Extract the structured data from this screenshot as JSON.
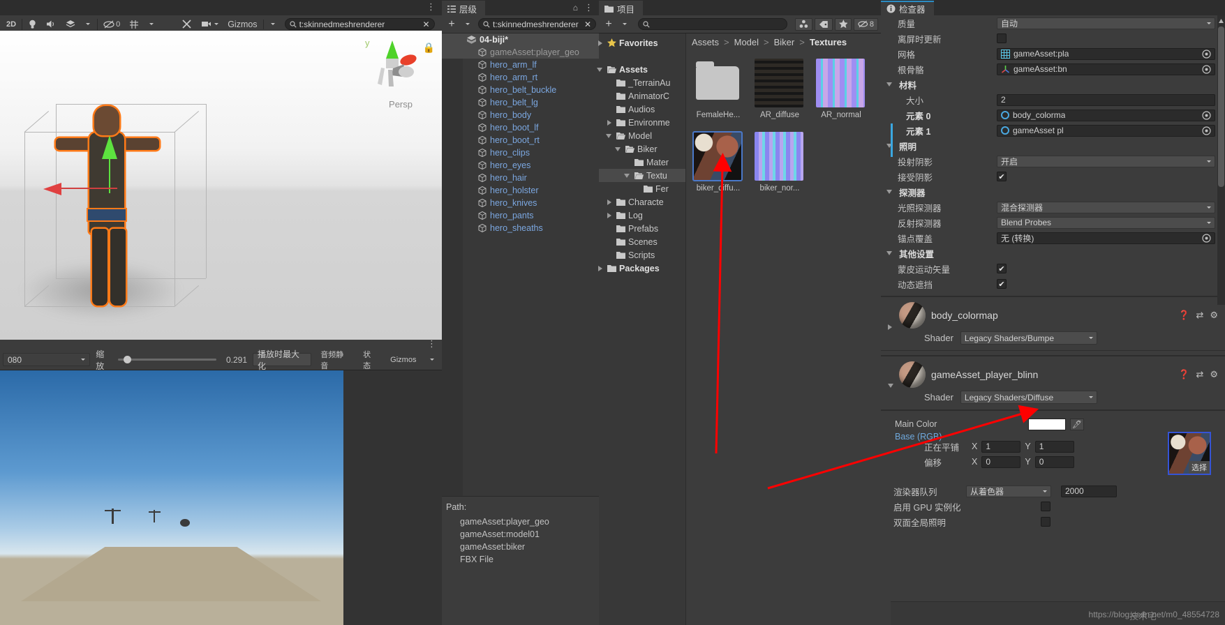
{
  "scene": {
    "toolbar": {
      "mode_2d": "2D",
      "light_icon": "lightbulb-icon",
      "audio_icon": "speaker-icon",
      "fx_icon": "effects-icon",
      "hidden_count": "0",
      "grid_icon": "grid-icon",
      "tools_icon": "tools-icon",
      "camera_icon": "camera-icon",
      "gizmos_label": "Gizmos",
      "search_value": "t:skinnedmeshrenderer",
      "search_icon": "search-icon",
      "clear_icon": "close-icon"
    },
    "persp_label": "Persp",
    "axis_y": "y",
    "lock_icon": "lock-icon"
  },
  "game": {
    "toolbar": {
      "resolution": "080",
      "zoom_label": "缩放",
      "zoom_value": "0.291",
      "maximize_label": "播放时最大化",
      "mute_label": "音频静音",
      "stats_label": "状态",
      "gizmos_label": "Gizmos"
    }
  },
  "hierarchy": {
    "tab_label": "层级",
    "tab_icon": "hierarchy-icon",
    "add_label": "+",
    "search_value": "t:skinnedmeshrenderer",
    "lock_icon": "lock-icon",
    "menu_icon": "kebab-icon",
    "root": "04-biji*",
    "items": [
      {
        "label": "gameAsset:player_geo",
        "state": "selected"
      },
      {
        "label": "hero_arm_lf",
        "state": "normal"
      },
      {
        "label": "hero_arm_rt",
        "state": "normal"
      },
      {
        "label": "hero_belt_buckle",
        "state": "normal"
      },
      {
        "label": "hero_belt_lg",
        "state": "normal"
      },
      {
        "label": "hero_body",
        "state": "normal"
      },
      {
        "label": "hero_boot_lf",
        "state": "normal"
      },
      {
        "label": "hero_boot_rt",
        "state": "normal"
      },
      {
        "label": "hero_clips",
        "state": "normal"
      },
      {
        "label": "hero_eyes",
        "state": "normal"
      },
      {
        "label": "hero_hair",
        "state": "normal"
      },
      {
        "label": "hero_holster",
        "state": "normal"
      },
      {
        "label": "hero_knives",
        "state": "normal"
      },
      {
        "label": "hero_pants",
        "state": "normal"
      },
      {
        "label": "hero_sheaths",
        "state": "normal"
      }
    ],
    "path_panel": {
      "title": "Path:",
      "items": [
        "gameAsset:player_geo",
        "gameAsset:model01",
        "gameAsset:biker",
        "FBX File"
      ]
    }
  },
  "project": {
    "tab_label": "项目",
    "tab_icon": "folder-icon",
    "add_label": "+",
    "search_value": "",
    "search_icon": "search-icon",
    "toolbar_icons": [
      "avatar-icon",
      "tag-icon",
      "star-icon",
      "hidden-icon"
    ],
    "hidden_count": "8",
    "lock_icon": "lock-icon",
    "menu_icon": "kebab-icon",
    "tree": [
      {
        "label": "Favorites",
        "indent": 0,
        "arrow": "closed",
        "icon": "star-icon",
        "bold": true
      },
      {
        "label": "",
        "indent": 0,
        "arrow": "none",
        "icon": "none",
        "bold": false
      },
      {
        "label": "Assets",
        "indent": 0,
        "arrow": "open",
        "icon": "folder-open-icon",
        "bold": true
      },
      {
        "label": "_TerrainAu",
        "indent": 1,
        "arrow": "none",
        "icon": "folder-icon",
        "bold": false
      },
      {
        "label": "AnimatorC",
        "indent": 1,
        "arrow": "none",
        "icon": "folder-icon",
        "bold": false
      },
      {
        "label": "Audios",
        "indent": 1,
        "arrow": "none",
        "icon": "folder-icon",
        "bold": false
      },
      {
        "label": "Environme",
        "indent": 1,
        "arrow": "closed",
        "icon": "folder-icon",
        "bold": false
      },
      {
        "label": "Model",
        "indent": 1,
        "arrow": "open",
        "icon": "folder-open-icon",
        "bold": false
      },
      {
        "label": "Biker",
        "indent": 2,
        "arrow": "open",
        "icon": "folder-open-icon",
        "bold": false
      },
      {
        "label": "Mater",
        "indent": 3,
        "arrow": "none",
        "icon": "folder-icon",
        "bold": false
      },
      {
        "label": "Textu",
        "indent": 3,
        "arrow": "open",
        "icon": "folder-open-icon",
        "bold": false,
        "selected": true
      },
      {
        "label": "Fer",
        "indent": 4,
        "arrow": "none",
        "icon": "folder-icon",
        "bold": false
      },
      {
        "label": "Characte",
        "indent": 1,
        "arrow": "closed",
        "icon": "folder-icon",
        "bold": false
      },
      {
        "label": "Log",
        "indent": 1,
        "arrow": "closed",
        "icon": "folder-icon",
        "bold": false
      },
      {
        "label": "Prefabs",
        "indent": 1,
        "arrow": "none",
        "icon": "folder-icon",
        "bold": false
      },
      {
        "label": "Scenes",
        "indent": 1,
        "arrow": "none",
        "icon": "folder-icon",
        "bold": false
      },
      {
        "label": "Scripts",
        "indent": 1,
        "arrow": "none",
        "icon": "folder-icon",
        "bold": false
      },
      {
        "label": "Packages",
        "indent": 0,
        "arrow": "closed",
        "icon": "folder-icon",
        "bold": true
      }
    ],
    "breadcrumb": [
      "Assets",
      "Model",
      "Biker",
      "Textures"
    ],
    "assets": [
      {
        "label": "FemaleHe...",
        "kind": "folder"
      },
      {
        "label": "AR_diffuse",
        "kind": "texture-ar-diffuse"
      },
      {
        "label": "AR_normal",
        "kind": "texture-ar-normal"
      },
      {
        "label": "biker_diffu...",
        "kind": "texture-diffuse",
        "selected": true
      },
      {
        "label": "biker_nor...",
        "kind": "texture-normal"
      }
    ]
  },
  "inspector": {
    "tab_label": "检查器",
    "tab_icon": "info-icon",
    "renderer": {
      "rows": [
        {
          "label": "质量",
          "indent": 1,
          "type": "dropdown",
          "value": "自动"
        },
        {
          "label": "离屏时更新",
          "indent": 1,
          "type": "checkbox",
          "value": false
        },
        {
          "label": "网格",
          "indent": 1,
          "type": "object",
          "value": "gameAsset:pla",
          "icon": "mesh-icon"
        },
        {
          "label": "根骨骼",
          "indent": 1,
          "type": "object",
          "value": "gameAsset:bn",
          "icon": "transform-icon"
        },
        {
          "label": "材料",
          "indent": 0,
          "type": "header",
          "value": ""
        },
        {
          "label": "大小",
          "indent": 2,
          "type": "text",
          "value": "2"
        },
        {
          "label": "元素 0",
          "indent": 2,
          "type": "object-mat",
          "value": "body_colorma",
          "bold": true
        },
        {
          "label": "元素 1",
          "indent": 2,
          "type": "object-mat",
          "value": "gameAsset pl",
          "bold": true
        },
        {
          "label": "照明",
          "indent": 0,
          "type": "header",
          "value": ""
        },
        {
          "label": "投射阴影",
          "indent": 1,
          "type": "dropdown",
          "value": "开启"
        },
        {
          "label": "接受阴影",
          "indent": 1,
          "type": "checkbox",
          "value": true
        },
        {
          "label": "探测器",
          "indent": 0,
          "type": "header",
          "value": ""
        },
        {
          "label": "光照探测器",
          "indent": 1,
          "type": "dropdown",
          "value": "混合探测器"
        },
        {
          "label": "反射探测器",
          "indent": 1,
          "type": "dropdown",
          "value": "Blend Probes"
        },
        {
          "label": "锚点覆盖",
          "indent": 1,
          "type": "object",
          "value": "无 (转换)"
        },
        {
          "label": "其他设置",
          "indent": 0,
          "type": "header",
          "value": ""
        },
        {
          "label": "蒙皮运动矢量",
          "indent": 1,
          "type": "checkbox",
          "value": true
        },
        {
          "label": "动态遮挡",
          "indent": 1,
          "type": "checkbox",
          "value": true
        }
      ]
    },
    "materials": [
      {
        "name": "body_colormap",
        "shader_label": "Shader",
        "shader_value": "Legacy Shaders/Bumpe",
        "expanded": false,
        "icons": [
          "help-icon",
          "preset-icon",
          "gear-icon"
        ]
      },
      {
        "name": "gameAsset_player_blinn",
        "shader_label": "Shader",
        "shader_value": "Legacy Shaders/Diffuse",
        "expanded": true,
        "icons": [
          "help-icon",
          "preset-icon",
          "gear-icon"
        ],
        "properties": {
          "main_color_label": "Main Color",
          "main_color_value": "#ffffff",
          "base_rgb_label": "Base (RGB)",
          "tiling_label": "正在平铺",
          "tiling_x": "1",
          "tiling_y": "1",
          "offset_label": "偏移",
          "offset_x": "0",
          "offset_y": "0",
          "select_label": "选择",
          "x_label": "X",
          "y_label": "Y"
        }
      }
    ],
    "render_queue": {
      "label": "渲染器队列",
      "mode": "从着色器",
      "value": "2000"
    },
    "gpu_instancing": {
      "label": "启用 GPU 实例化",
      "value": false
    },
    "double_sided_gi": {
      "label": "双面全局照明",
      "value": false
    },
    "watermark": "https://blog.csdn.net/m0_48554728",
    "watermark_cn": "技术宅"
  }
}
